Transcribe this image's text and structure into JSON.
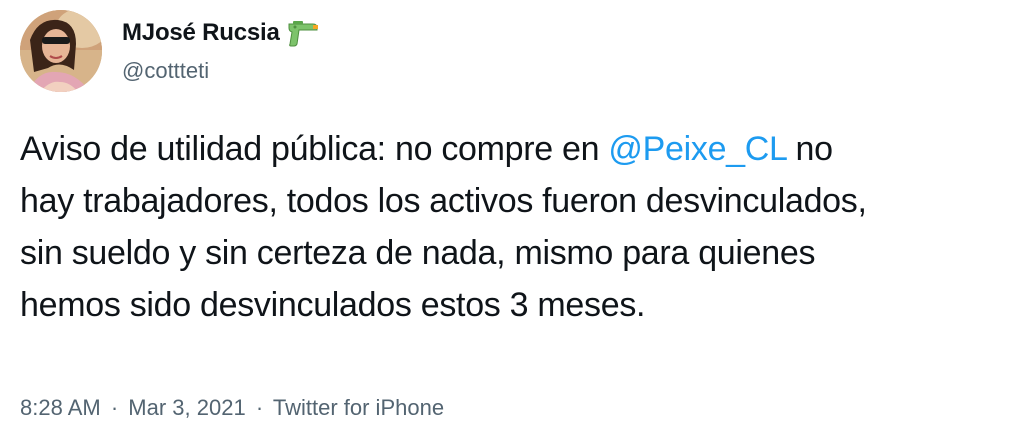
{
  "author": {
    "display_name": "MJosé Rucsia",
    "badge_icon": "water-pistol-icon",
    "handle": "@cottteti"
  },
  "tweet": {
    "lines": [
      {
        "before": "Aviso de utilidad pública: no compre en ",
        "mention": "@Peixe_CL",
        "after": " no"
      },
      {
        "text": "hay trabajadores, todos los activos fueron desvinculados,"
      },
      {
        "text": "sin sueldo y sin certeza de nada, mismo para quienes"
      },
      {
        "text": "hemos sido desvinculados estos 3 meses."
      }
    ]
  },
  "meta": {
    "time": "8:28 AM",
    "separator": "·",
    "date": "Mar 3, 2021",
    "source": "Twitter for iPhone"
  },
  "colors": {
    "text": "#0f1419",
    "secondary": "#536471",
    "link": "#1d9bf0"
  }
}
